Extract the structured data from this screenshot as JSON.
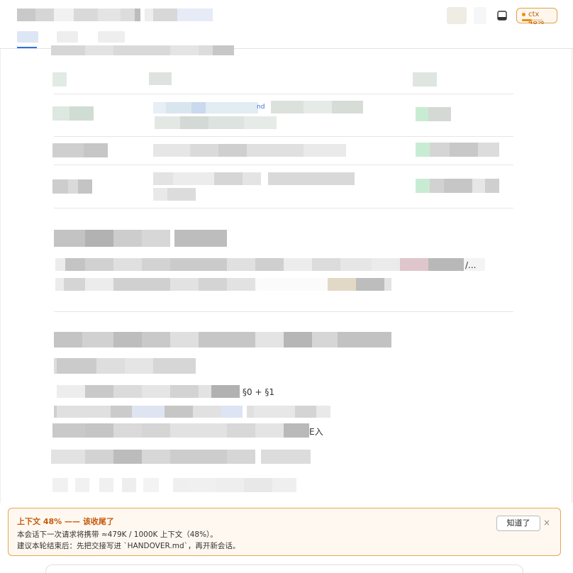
{
  "header": {
    "context_badge": {
      "label": "ctx 48%",
      "percent": 48,
      "color": "#f08c00"
    }
  },
  "content": {
    "table_link_fragment": "nd",
    "heading_fragment": "/...",
    "line_1_suffix": "§0 + §1",
    "line_3_suffix": "E入"
  },
  "banner": {
    "title": "上下文 48% —— 该收尾了",
    "line1": "本会话下一次请求将携带 ≈479K / 1000K 上下文（48%）。",
    "line2": "建议本轮结束后：先把交接写进 `HANDOVER.md`，再开新会话。",
    "ack_label": "知道了",
    "close_glyph": "×",
    "accent_color": "#c5590c"
  }
}
